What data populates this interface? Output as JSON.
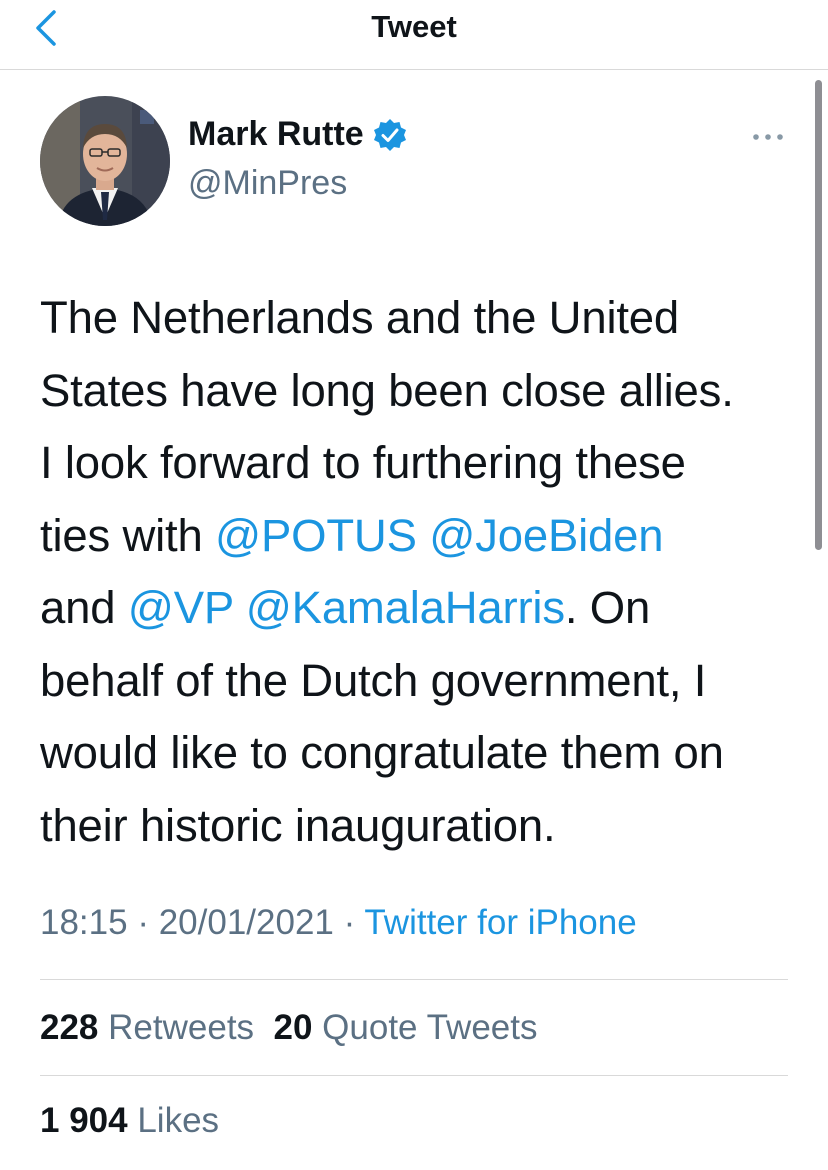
{
  "nav": {
    "title": "Tweet"
  },
  "author": {
    "name": "Mark Rutte",
    "handle": "@MinPres"
  },
  "tweet": {
    "lines": [
      {
        "a": "The Netherlands and the United"
      },
      {
        "a": "States have long been close allies."
      },
      {
        "a": "I look forward to furthering these"
      },
      {
        "a": "ties with ",
        "m1": "@POTUS",
        "s1": " ",
        "m2": "@JoeBiden"
      },
      {
        "a": "and ",
        "m1": "@VP",
        "s1": " ",
        "m2": "@KamalaHarris",
        "b": ". On"
      },
      {
        "a": "behalf of the Dutch government, I"
      },
      {
        "a": "would like to congratulate them on"
      },
      {
        "a": "their historic inauguration."
      }
    ]
  },
  "meta": {
    "time": "18:15",
    "sep1": " · ",
    "date": "20/01/2021",
    "sep2": " · ",
    "source": "Twitter for iPhone"
  },
  "stats": {
    "retweets": "228",
    "retweets_label": "Retweets",
    "quotes": "20",
    "quotes_label": "Quote Tweets",
    "likes": "1 904",
    "likes_label": "Likes"
  },
  "colors": {
    "accent": "#1b95e0",
    "text": "#0f1419",
    "secondary": "#5b7083",
    "divider": "#d9d9d9"
  }
}
